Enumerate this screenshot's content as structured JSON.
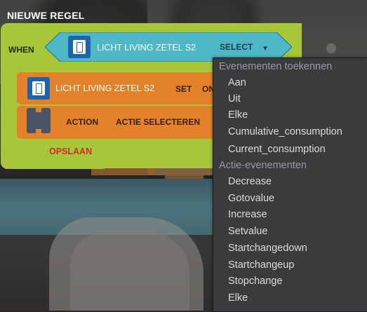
{
  "header": {
    "title": "NIEUWE REGEL"
  },
  "rule": {
    "when_label": "WHEN",
    "trigger": {
      "device": "LICHT LIVING ZETEL S2",
      "select_label": "SELECT",
      "caret": "▼"
    },
    "action_device": {
      "device": "LICHT LIVING ZETEL S2",
      "set_label": "SET",
      "on_label": "ON"
    },
    "action_generic": {
      "label": "ACTION",
      "select_label": "ACTIE SELECTEREN"
    },
    "save_label": "OPSLAAN"
  },
  "dropdown": {
    "sections": [
      {
        "header": "Evenementen toekennen",
        "items": [
          "Aan",
          "Uit",
          "Elke",
          "Cumulative_consumption",
          "Current_consumption"
        ]
      },
      {
        "header": "Actie-evenementen",
        "items": [
          "Decrease",
          "Gotovalue",
          "Increase",
          "Setvalue",
          "Startchangedown",
          "Startchangeup",
          "Stopchange",
          "Elke"
        ]
      }
    ]
  },
  "icons": {
    "trigger_icon": "switch-device-icon",
    "action_icon": "switch-device-icon",
    "slot_icon": "empty-slot-icon"
  },
  "colors": {
    "rule_block": "#a8c63a",
    "trigger_block": "#4fb8c8",
    "action_block": "#e3822a",
    "device_icon": "#1f63a8",
    "save": "#d62a2a",
    "dropdown_bg": "#3b3b3d"
  }
}
